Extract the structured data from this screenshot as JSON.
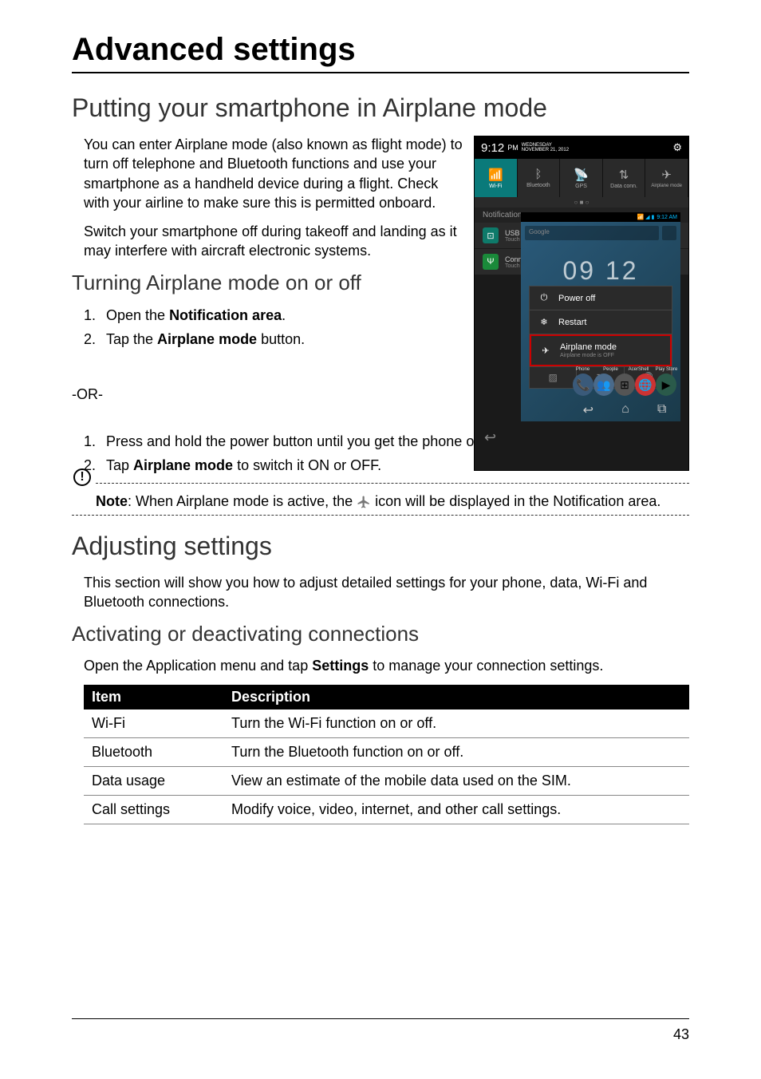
{
  "page": {
    "number": "43",
    "title": "Advanced settings"
  },
  "section1": {
    "title": "Putting your smartphone in Airplane mode",
    "para1": "You can enter Airplane mode (also known as flight mode) to turn off telephone and Bluetooth functions and use your smartphone as a handheld device during a flight. Check with your airline to make sure this is permitted onboard.",
    "para2": "Switch your smartphone off during takeoff and landing as it may interfere with aircraft electronic systems.",
    "sub1": {
      "title": "Turning Airplane mode on or off",
      "step1_prefix": "Open the ",
      "step1_bold": "Notification area",
      "step1_suffix": ".",
      "step2_prefix": "Tap the ",
      "step2_bold": "Airplane mode",
      "step2_suffix": " button.",
      "or": "-OR-",
      "alt1": "Press and hold the power button until you get the phone options menu.",
      "alt2_prefix": "Tap ",
      "alt2_bold": "Airplane mode",
      "alt2_suffix": " to switch it ON or OFF."
    },
    "note": {
      "label": "Note",
      "prefix": ": When Airplane mode is active, the ",
      "suffix": " icon will be displayed in the Notification area."
    }
  },
  "section2": {
    "title": "Adjusting settings",
    "intro": "This section will show you how to adjust detailed settings for your phone, data, Wi-Fi and Bluetooth connections.",
    "sub1": {
      "title": "Activating or deactivating connections",
      "intro_prefix": "Open the Application menu and tap ",
      "intro_bold": "Settings",
      "intro_suffix": " to manage your connection settings."
    },
    "table": {
      "headers": {
        "col1": "Item",
        "col2": "Description"
      },
      "rows": [
        {
          "item": "Wi-Fi",
          "desc": "Turn the Wi-Fi function on or off."
        },
        {
          "item": "Bluetooth",
          "desc": "Turn the Bluetooth function on or off."
        },
        {
          "item": "Data usage",
          "desc": "View an estimate of the mobile data used on the SIM."
        },
        {
          "item": "Call settings",
          "desc": "Modify voice, video, internet, and other call settings."
        }
      ]
    }
  },
  "phone": {
    "statusbar": {
      "time": "9:12",
      "ampm": "PM",
      "date_day": "WEDNESDAY",
      "date_full": "NOVEMBER 21, 2012",
      "right_time": "9:12 AM"
    },
    "quicksettings": [
      {
        "key": "wifi",
        "label": "Wi-Fi",
        "icon": "wifi-icon"
      },
      {
        "key": "bluetooth",
        "label": "Bluetooth",
        "icon": "bluetooth-icon"
      },
      {
        "key": "gps",
        "label": "GPS",
        "icon": "gps-icon"
      },
      {
        "key": "dataconn",
        "label": "Data conn.",
        "icon": "data-icon"
      },
      {
        "key": "airplane",
        "label": "Airplane mode",
        "icon": "airplane-icon"
      }
    ],
    "notifications_label": "Notifications",
    "notifications": [
      {
        "title": "USB d",
        "sub": "Touch"
      },
      {
        "title": "Conn",
        "sub": "Touch"
      }
    ],
    "clock": "09 12",
    "search_placeholder": "Google",
    "power_menu": [
      {
        "label": "Power off",
        "icon": "power-icon"
      },
      {
        "label": "Restart",
        "icon": "restart-icon"
      },
      {
        "label": "Airplane mode",
        "sub": "Airplane mode is OFF",
        "icon": "airplane-icon",
        "highlighted": true
      }
    ],
    "bottom_quick": [
      "vibrate-icon",
      "refresh-icon",
      "sound-icon"
    ],
    "dock_labels": [
      "Phone",
      "People",
      "AcerShell",
      "Play Store"
    ],
    "dock_icons": [
      "phone-icon",
      "people-icon",
      "apps-icon",
      "browser-icon",
      "play-icon"
    ]
  }
}
